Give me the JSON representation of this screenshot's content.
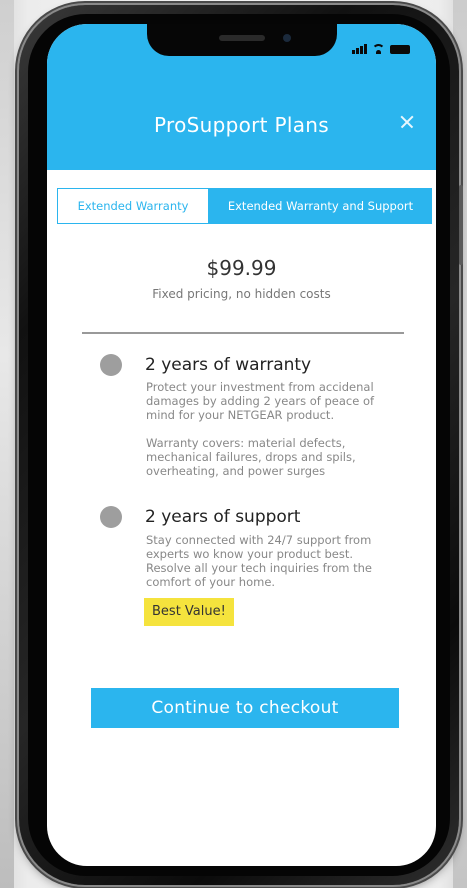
{
  "header": {
    "title": "ProSupport Plans",
    "close_icon": "close-icon"
  },
  "tabs": [
    {
      "label": "Extended Warranty",
      "selected": false
    },
    {
      "label": "Extended Warranty and Support",
      "selected": true
    }
  ],
  "pricing": {
    "price": "$99.99",
    "subtitle": "Fixed pricing, no hidden costs"
  },
  "features": [
    {
      "title": "2 years of warranty",
      "description": "Protect your investment from accidenal damages by adding 2 years of peace of mind for your NETGEAR product.",
      "extra": "Warranty covers: material defects, mechanical failures, drops and spils, overheating, and power surges"
    },
    {
      "title": "2 years of support",
      "description": "Stay connected with 24/7 support from experts wo know your product best. Resolve all your tech inquiries from the comfort of your home."
    }
  ],
  "badge": "Best Value!",
  "checkout_label": "Continue to checkout",
  "colors": {
    "accent": "#2bb5ee",
    "badge": "#f5e33d",
    "bullet": "#9e9e9e"
  }
}
